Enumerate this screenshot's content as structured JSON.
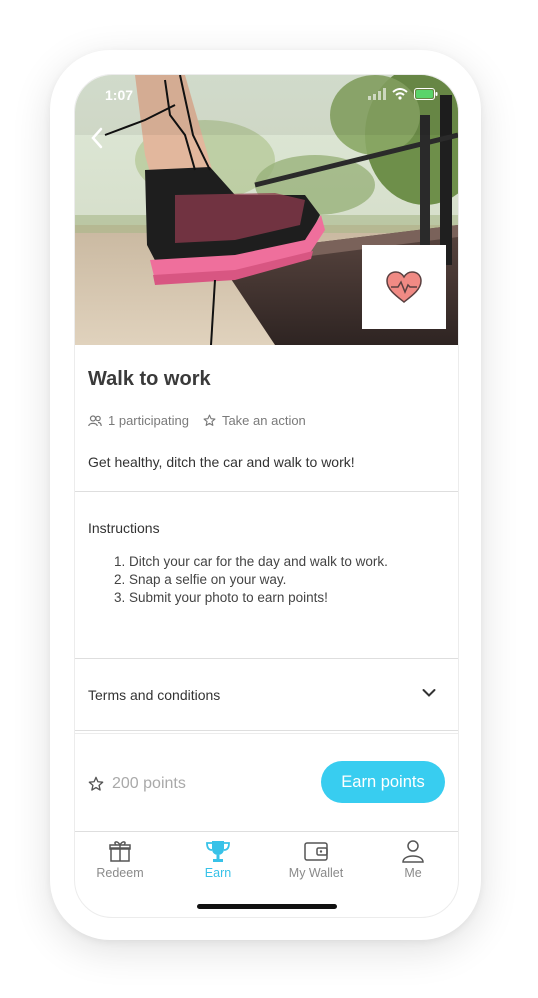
{
  "status_bar": {
    "time": "1:07"
  },
  "challenge": {
    "title": "Walk to work",
    "participants": "1 participating",
    "action_type": "Take an action",
    "description": "Get healthy, ditch the car and walk to work!",
    "badge_icon": "heart-rate-icon"
  },
  "instructions": {
    "title": "Instructions",
    "steps": [
      "Ditch your car for the day and walk to work.",
      "Snap a selfie on your way.",
      "Submit your photo to earn points!"
    ]
  },
  "terms": {
    "label": "Terms and conditions"
  },
  "reward": {
    "points": "200 points",
    "button_label": "Earn points"
  },
  "tabbar": {
    "items": [
      {
        "label": "Redeem",
        "icon": "gift-icon",
        "active": false
      },
      {
        "label": "Earn",
        "icon": "trophy-icon",
        "active": true
      },
      {
        "label": "My Wallet",
        "icon": "wallet-icon",
        "active": false
      },
      {
        "label": "Me",
        "icon": "user-icon",
        "active": false
      }
    ]
  },
  "colors": {
    "accent": "#38cdf0",
    "heart": "#f08a84"
  }
}
